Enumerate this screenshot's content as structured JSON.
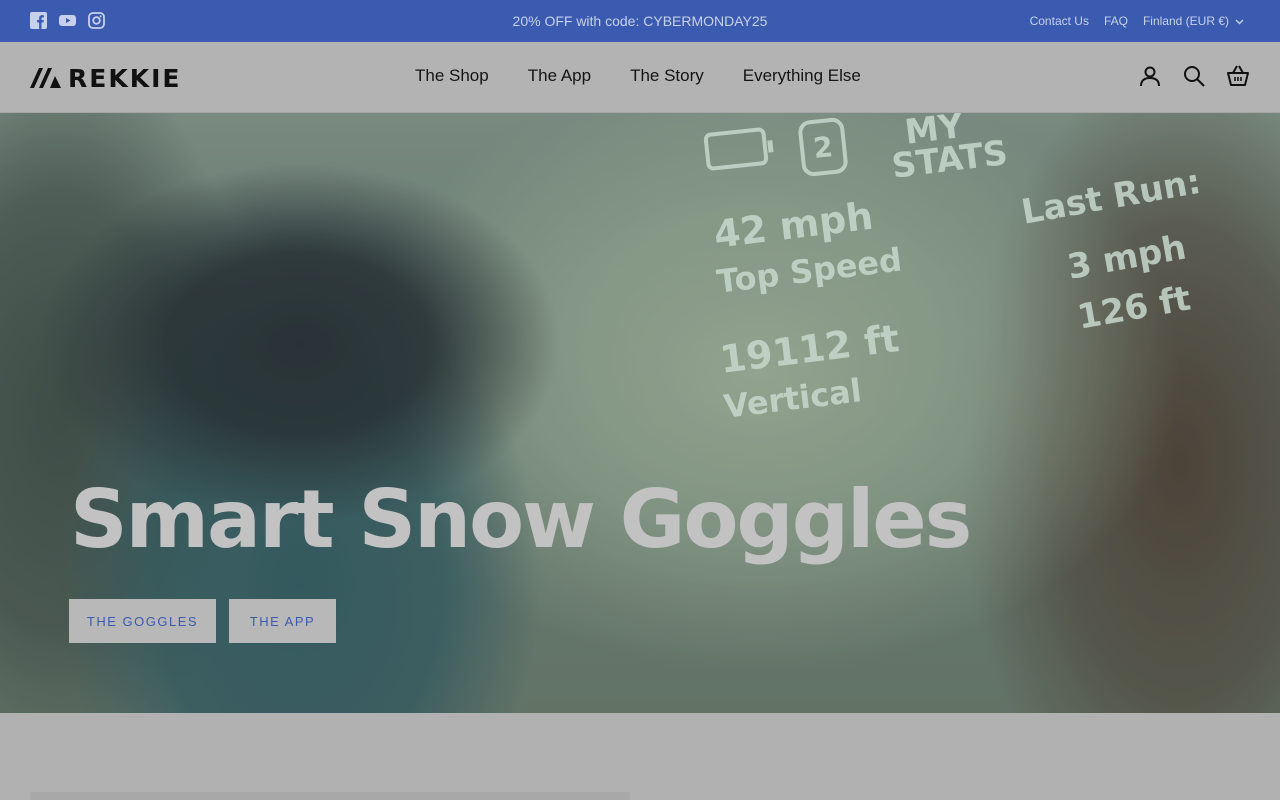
{
  "announcement": {
    "socials": [
      {
        "icon": "facebook-icon"
      },
      {
        "icon": "youtube-icon"
      },
      {
        "icon": "instagram-icon"
      }
    ],
    "promo_text": "20% OFF with code: CYBERMONDAY25",
    "contact_label": "Contact Us",
    "faq_label": "FAQ",
    "region_label": "Finland (EUR €)",
    "background_color": "#3a5bb0"
  },
  "header": {
    "logo_text": "REKKIE",
    "nav": [
      "The Shop",
      "The App",
      "The Story",
      "Everything Else"
    ],
    "icons": [
      "account-icon",
      "search-icon",
      "cart-icon"
    ]
  },
  "hero": {
    "hud": {
      "badge_number": "2",
      "stats_title_line1": "MY",
      "stats_title_line2": "STATS",
      "top_speed_value": "42 mph",
      "top_speed_label": "Top Speed",
      "vertical_value": "19112 ft",
      "vertical_label": "Vertical",
      "last_run_label": "Last Run:",
      "last_run_speed": "3 mph",
      "last_run_distance": "126 ft"
    },
    "title": "Smart Snow Goggles",
    "buttons": [
      "THE GOGGLES",
      "THE APP"
    ],
    "accent_color": "#3a5bb0"
  }
}
